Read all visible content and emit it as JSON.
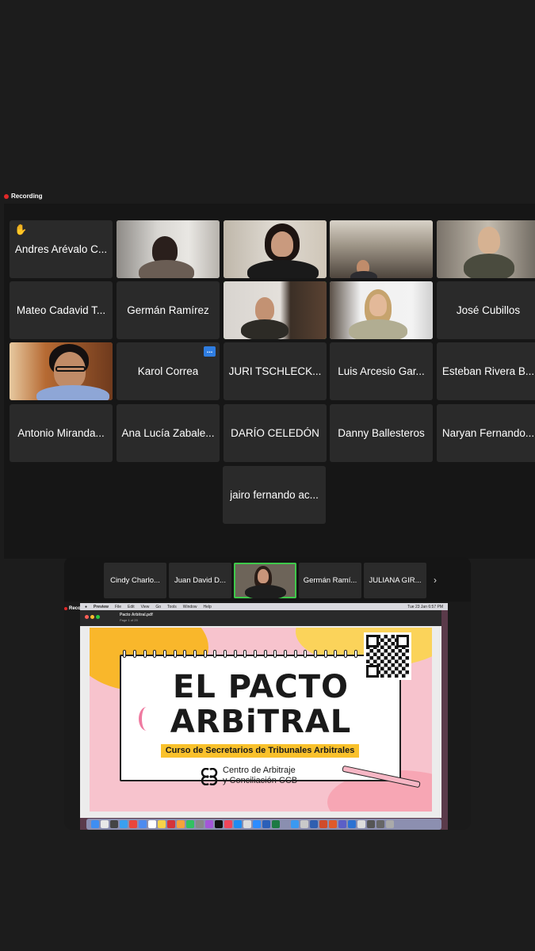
{
  "recording_label": "Recording",
  "participants": [
    {
      "name": "Andres Arévalo C...",
      "hand_raised": true
    },
    {
      "name": "",
      "video": true
    },
    {
      "name": "",
      "video": true
    },
    {
      "name": "",
      "video": true
    },
    {
      "name": "",
      "video": true
    },
    {
      "name": "Mateo Cadavid T..."
    },
    {
      "name": "Germán Ramírez"
    },
    {
      "name": "",
      "video": true,
      "active_speaker": true
    },
    {
      "name": "",
      "video": true
    },
    {
      "name": "José Cubillos"
    },
    {
      "name": "",
      "video": true
    },
    {
      "name": "Karol Correa",
      "more_menu": "..."
    },
    {
      "name": "JURI TSCHLECK..."
    },
    {
      "name": "Luis Arcesio Gar..."
    },
    {
      "name": "Esteban Rivera B..."
    },
    {
      "name": "Antonio Miranda..."
    },
    {
      "name": "Ana Lucía Zabale..."
    },
    {
      "name": "DARÍO CELEDÓN"
    },
    {
      "name": "Danny Ballesteros"
    },
    {
      "name": "Naryan Fernando..."
    },
    {
      "name": "jairo fernando ac..."
    }
  ],
  "shared_screen": {
    "strip": [
      "Cindy Charlo...",
      "Juan David D...",
      "",
      "Germán Ramí...",
      "JULIANA GIR..."
    ],
    "recording_label": "Recording",
    "mac_menubar": [
      "Preview",
      "File",
      "Edit",
      "View",
      "Go",
      "Tools",
      "Window",
      "Help"
    ],
    "mac_clock": "Tue 23 Jan 6:57 PM",
    "file_name": "Pacto Arbitral.pdf",
    "file_page": "Page 1 of 29",
    "slide": {
      "title_line1": "EL PACTO",
      "title_line2": "ARBiTRAL",
      "subtitle": "Curso de Secretarios de Tribunales Arbitrales",
      "org_line1": "Centro de Arbitraje",
      "org_line2": "y Conciliación CCB"
    }
  },
  "colors": {
    "active_border": "#3ec94a",
    "recording_dot": "#e02828",
    "more_button": "#2f7de1"
  }
}
